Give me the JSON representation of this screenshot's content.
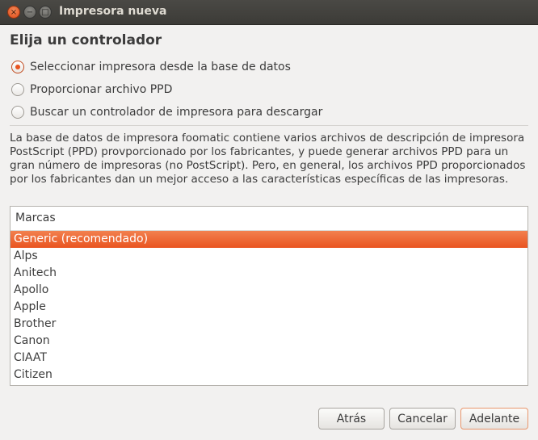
{
  "window": {
    "title": "Impresora nueva",
    "buttons": {
      "close": "×",
      "minimize": "−",
      "maximize": "□"
    }
  },
  "heading": "Elija un controlador",
  "options": [
    {
      "label": "Seleccionar impresora desde la base de datos",
      "checked": true
    },
    {
      "label": "Proporcionar archivo PPD",
      "checked": false
    },
    {
      "label": "Buscar un controlador de impresora para descargar",
      "checked": false
    }
  ],
  "description": "La base de datos de impresora foomatic contiene varios archivos de descripción de impresora PostScript (PPD) provporcionado por los fabricantes, y puede generar archivos PPD para un gran número de impresoras (no PostScript). Pero, en general, los archivos PPD proporcionados por los fabricantes dan un mejor acceso a las características específicas de las impresoras.",
  "brands": {
    "header": "Marcas",
    "items": [
      "Generic (recomendado)",
      "Alps",
      "Anitech",
      "Apollo",
      "Apple",
      "Brother",
      "Canon",
      "CIAAT",
      "Citizen"
    ],
    "selected_index": 0
  },
  "buttons": {
    "back": "Atrás",
    "cancel": "Cancelar",
    "next": "Adelante"
  },
  "colors": {
    "accent": "#e95420",
    "titlebar": "#3c3b37",
    "background": "#f2f1f0"
  }
}
